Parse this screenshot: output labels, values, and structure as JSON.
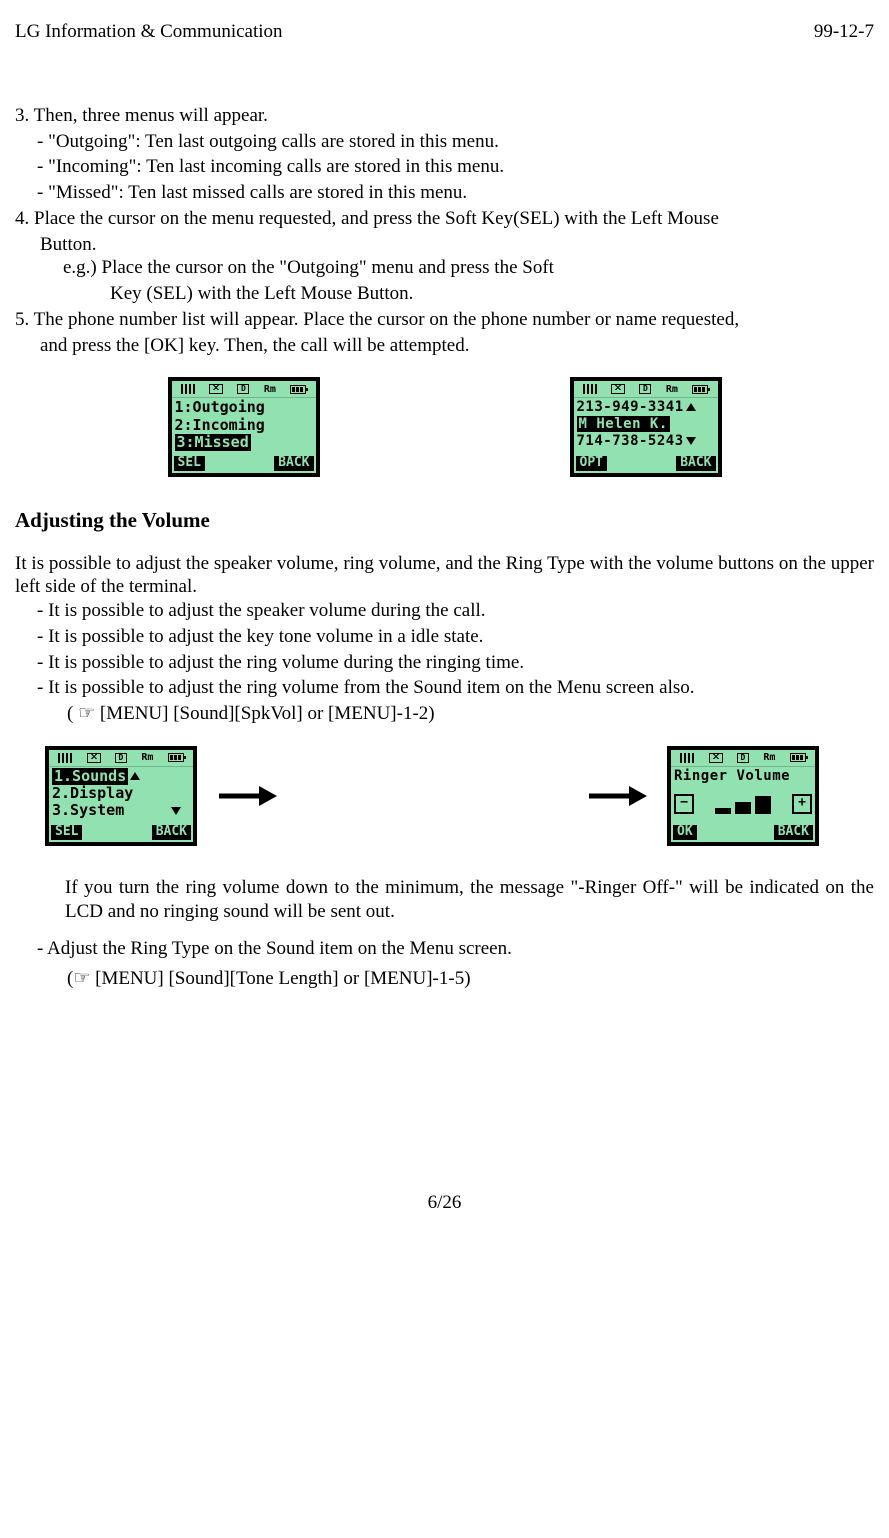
{
  "header": {
    "left": "LG Information & Communication",
    "right": "99-12-7"
  },
  "sec1": {
    "n3": "3.  Then, three menus will appear.",
    "d1": "-   \"Outgoing\": Ten last outgoing calls are stored in this menu.",
    "d2": "-   \"Incoming\": Ten last incoming calls are stored in this menu.",
    "d3": "-   \"Missed\": Ten last missed calls are stored in this menu.",
    "n4a": "4.  Place the cursor on the menu requested, and press the Soft Key(SEL) with the Left Mouse",
    "n4b": "Button.",
    "n4c": "e.g.) Place the cursor on the \"Outgoing\" menu and press the Soft",
    "n4d": "Key (SEL) with the Left Mouse Button.",
    "n5a": "5.  The phone number list will appear. Place the cursor on the phone number or name requested,",
    "n5b": "and press the [OK] key. Then, the call will be attempted."
  },
  "screen1": {
    "l1": "1:Outgoing",
    "l2": "2:Incoming",
    "l3": "3:Missed",
    "left": "SEL",
    "right": "BACK"
  },
  "screen2": {
    "l1": "213-949-3341",
    "l2": "M Helen K.",
    "l3": "714-738-5243",
    "left": "OPT",
    "right": "BACK"
  },
  "title2": "Adjusting the Volume",
  "sec2": {
    "p1": "It is possible to adjust the speaker volume, ring volume, and the Ring Type with the volume buttons on the upper left side of the terminal.",
    "d1": "-   It is possible to adjust the speaker volume during the call.",
    "d2": "-   It is possible to adjust the key tone volume in a idle state.",
    "d3": "-   It is possible to adjust the ring volume during the ringing time.",
    "d4": "-   It is possible to adjust the ring volume from the Sound item on the Menu screen also.",
    "d4b": "( ☞ [MENU] [Sound][SpkVol] or [MENU]-1-2)"
  },
  "screen3": {
    "l1": "1.Sounds",
    "l2": "2.Display",
    "l3": "3.System",
    "left": "SEL",
    "right": "BACK"
  },
  "screen4": {
    "title": "Ringer Volume",
    "minus": "−",
    "plus": "+",
    "left": "OK",
    "right": "BACK"
  },
  "para3": "If you turn the ring volume down to the minimum, the message \"-Ringer Off-\" will be indicated on the LCD and no ringing sound will be sent out.",
  "sec3": {
    "d1": "-   Adjust the Ring Type on the Sound item on the Menu screen.",
    "d1b": "(☞ [MENU] [Sound][Tone Length] or [MENU]-1-5)"
  },
  "statusbar": {
    "d": "D",
    "rm": "Rm"
  },
  "footer": "6/26"
}
